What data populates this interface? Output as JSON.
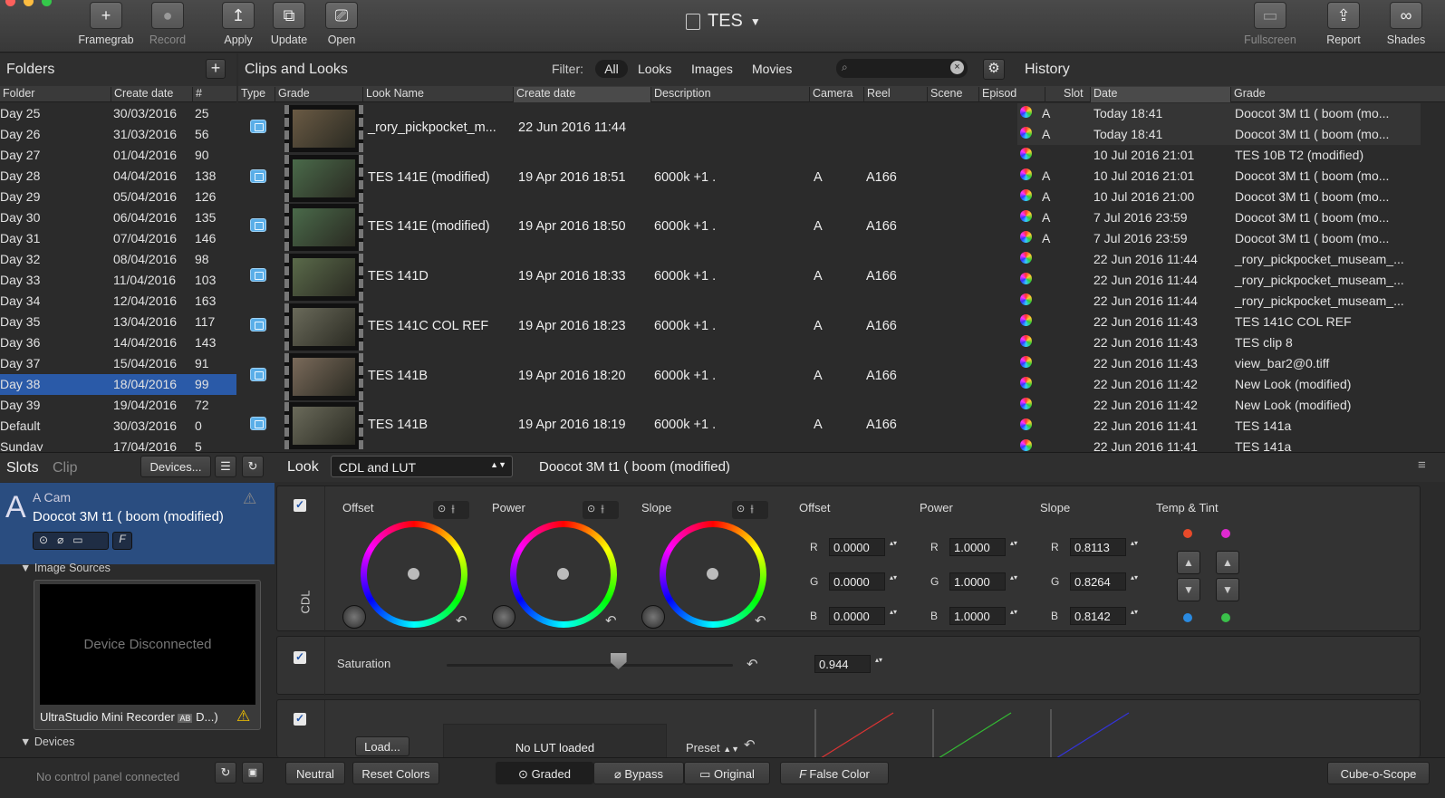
{
  "toolbar": {
    "framegrab": "Framegrab",
    "record": "Record",
    "apply": "Apply",
    "update": "Update",
    "open": "Open",
    "title": "TES",
    "fullscreen": "Fullscreen",
    "report": "Report",
    "shades": "Shades"
  },
  "folders": {
    "title": "Folders",
    "columns": [
      "Folder",
      "Create date",
      "#"
    ],
    "rows": [
      [
        "Day 25",
        "30/03/2016",
        "25"
      ],
      [
        "Day 26",
        "31/03/2016",
        "56"
      ],
      [
        "Day 27",
        "01/04/2016",
        "90"
      ],
      [
        "Day 28",
        "04/04/2016",
        "138"
      ],
      [
        "Day 29",
        "05/04/2016",
        "126"
      ],
      [
        "Day 30",
        "06/04/2016",
        "135"
      ],
      [
        "Day 31",
        "07/04/2016",
        "146"
      ],
      [
        "Day 32",
        "08/04/2016",
        "98"
      ],
      [
        "Day 33",
        "11/04/2016",
        "103"
      ],
      [
        "Day 34",
        "12/04/2016",
        "163"
      ],
      [
        "Day 35",
        "13/04/2016",
        "117"
      ],
      [
        "Day 36",
        "14/04/2016",
        "143"
      ],
      [
        "Day 37",
        "15/04/2016",
        "91"
      ],
      [
        "Day 38",
        "18/04/2016",
        "99"
      ],
      [
        "Day 39",
        "19/04/2016",
        "72"
      ],
      [
        "Default",
        "30/03/2016",
        "0"
      ],
      [
        "Sunday",
        "17/04/2016",
        "5"
      ]
    ],
    "selected": "Day 38"
  },
  "clips": {
    "title": "Clips and Looks",
    "filter_label": "Filter:",
    "filters": [
      "All",
      "Looks",
      "Images",
      "Movies"
    ],
    "active_filter": "All",
    "columns": [
      "Type",
      "Grade",
      "Look Name",
      "Create date",
      "Description",
      "Camera",
      "Reel",
      "Scene",
      "Episod"
    ],
    "rows": [
      {
        "name": "_rory_pickpocket_m...",
        "date": "22 Jun 2016 11:44",
        "desc": "",
        "camera": "",
        "reel": ""
      },
      {
        "name": "TES 141E  (modified)",
        "date": "19 Apr 2016 18:51",
        "desc": "6000k +1 .",
        "camera": "A",
        "reel": "A166"
      },
      {
        "name": "TES 141E  (modified)",
        "date": "19 Apr 2016 18:50",
        "desc": "6000k +1 .",
        "camera": "A",
        "reel": "A166"
      },
      {
        "name": "TES 141D",
        "date": "19 Apr 2016 18:33",
        "desc": "6000k +1 .",
        "camera": "A",
        "reel": "A166"
      },
      {
        "name": "TES 141C COL REF",
        "date": "19 Apr 2016 18:23",
        "desc": "6000k +1 .",
        "camera": "A",
        "reel": "A166"
      },
      {
        "name": "TES 141B",
        "date": "19 Apr 2016 18:20",
        "desc": "6000k +1 .",
        "camera": "A",
        "reel": "A166"
      },
      {
        "name": "TES 141B",
        "date": "19 Apr 2016 18:19",
        "desc": "6000k +1 .",
        "camera": "A",
        "reel": "A166"
      }
    ]
  },
  "history": {
    "title": "History",
    "columns": [
      "Slot",
      "Date",
      "Grade"
    ],
    "rows": [
      [
        "A",
        "Today 18:41",
        "Doocot  3M t1 ( boom (mo..."
      ],
      [
        "A",
        "Today 18:41",
        "Doocot  3M t1 ( boom (mo..."
      ],
      [
        "",
        "10 Jul 2016 21:01",
        "TES 10B T2 (modified)"
      ],
      [
        "A",
        "10 Jul 2016 21:01",
        "Doocot  3M t1 ( boom (mo..."
      ],
      [
        "A",
        "10 Jul 2016 21:00",
        "Doocot  3M t1 ( boom (mo..."
      ],
      [
        "A",
        "7 Jul 2016 23:59",
        "Doocot  3M t1 ( boom (mo..."
      ],
      [
        "A",
        "7 Jul 2016 23:59",
        "Doocot  3M t1 ( boom (mo..."
      ],
      [
        "",
        "22 Jun 2016 11:44",
        "_rory_pickpocket_museam_..."
      ],
      [
        "",
        "22 Jun 2016 11:44",
        "_rory_pickpocket_museam_..."
      ],
      [
        "",
        "22 Jun 2016 11:44",
        "_rory_pickpocket_museam_..."
      ],
      [
        "",
        "22 Jun 2016 11:43",
        "TES 141C COL REF"
      ],
      [
        "",
        "22 Jun 2016 11:43",
        "TES clip 8"
      ],
      [
        "",
        "22 Jun 2016 11:43",
        "view_bar2@0.tiff"
      ],
      [
        "",
        "22 Jun 2016 11:42",
        "New Look (modified)"
      ],
      [
        "",
        "22 Jun 2016 11:42",
        "New Look (modified)"
      ],
      [
        "",
        "22 Jun 2016 11:41",
        "TES 141a"
      ],
      [
        "",
        "22 Jun 2016 11:41",
        "TES 141a"
      ]
    ]
  },
  "slots": {
    "tab_slots": "Slots",
    "tab_clip": "Clip",
    "devices_btn": "Devices...",
    "slot_letter": "A",
    "camera": "A Cam",
    "look": "Doocot  3M t1 ( boom (modified)",
    "image_sources": "Image Sources",
    "device_status": "Device Disconnected",
    "device_name": "UltraStudio Mini Recorder",
    "device_tag": "AB",
    "device_suffix": "D...)",
    "devices_section": "Devices"
  },
  "look": {
    "label": "Look",
    "mode": "CDL and LUT",
    "name": "Doocot  3M t1 ( boom (modified)"
  },
  "cdl": {
    "side_label": "CDL",
    "wheels": [
      "Offset",
      "Power",
      "Slope"
    ],
    "offset": {
      "title": "Offset",
      "r": "0.0000",
      "g": "0.0000",
      "b": "0.0000"
    },
    "power": {
      "title": "Power",
      "r": "1.0000",
      "g": "1.0000",
      "b": "1.0000"
    },
    "slope": {
      "title": "Slope",
      "r": "0.8113",
      "g": "0.8264",
      "b": "0.8142"
    },
    "temp_tint": "Temp & Tint",
    "rgb": [
      "R",
      "G",
      "B"
    ]
  },
  "saturation": {
    "label": "Saturation",
    "value": "0.944",
    "level": 0.6
  },
  "lut": {
    "load": "Load...",
    "status": "No LUT loaded",
    "preset": "Preset"
  },
  "status": {
    "control_panel": "No control panel connected",
    "neutral": "Neutral",
    "reset": "Reset Colors",
    "graded": "Graded",
    "bypass": "Bypass",
    "original": "Original",
    "false_color": "False Color",
    "scope": "Cube-o-Scope"
  }
}
